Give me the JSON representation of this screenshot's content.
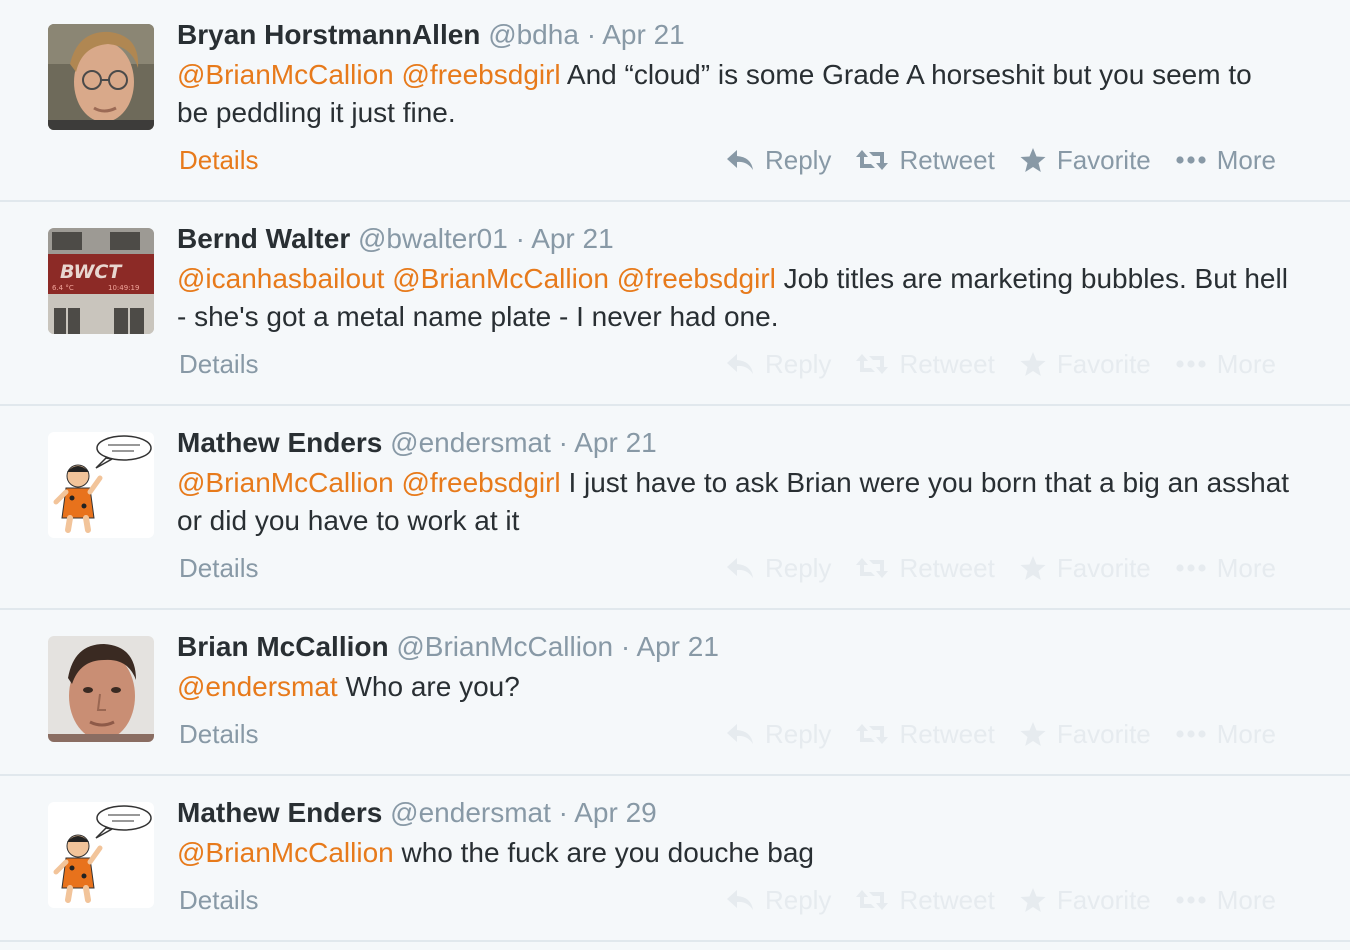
{
  "colors": {
    "mention": "#e77a1b",
    "name": "#292f33",
    "muted": "#8899a6",
    "faded_action": "#e6ebef",
    "background": "#f5f8fa"
  },
  "tweets": [
    {
      "fullname": "Bryan HorstmannAllen",
      "username": "@bdha",
      "separator": "·",
      "time": "Apr 21",
      "mentions": [
        "@BrianMcCallion",
        "@freebsdgirl"
      ],
      "text": "And “cloud” is some Grade A horseshit but you seem to be peddling it just fine.",
      "avatar_icon": "portrait-man-glasses-avatar",
      "details": "Details",
      "actions": {
        "reply": "Reply",
        "retweet": "Retweet",
        "favorite": "Favorite",
        "more": "More"
      }
    },
    {
      "fullname": "Bernd Walter",
      "username": "@bwalter01",
      "separator": "·",
      "time": "Apr 21",
      "mentions": [
        "@icanhasbailout",
        "@BrianMcCallion",
        "@freebsdgirl"
      ],
      "text": "Job titles are marketing bubbles. But hell - she's got a metal name plate - I never had one.",
      "avatar_icon": "bwct-building-sign-avatar",
      "avatar_sign_text": "BWCT",
      "avatar_sign_sub_left": "6.4 °C",
      "avatar_sign_sub_right": "10:49:19",
      "details": "Details",
      "actions": {
        "reply": "Reply",
        "retweet": "Retweet",
        "favorite": "Favorite",
        "more": "More"
      }
    },
    {
      "fullname": "Mathew Enders",
      "username": "@endersmat",
      "separator": "·",
      "time": "Apr 21",
      "mentions": [
        "@BrianMcCallion",
        "@freebsdgirl"
      ],
      "text": "I just have to ask Brian were you born that a big an asshat or did you have to work at it",
      "avatar_icon": "cartoon-caveman-avatar",
      "details": "Details",
      "actions": {
        "reply": "Reply",
        "retweet": "Retweet",
        "favorite": "Favorite",
        "more": "More"
      }
    },
    {
      "fullname": "Brian McCallion",
      "username": "@BrianMcCallion",
      "separator": "·",
      "time": "Apr 21",
      "mentions": [
        "@endersmat"
      ],
      "text": "Who are you?",
      "avatar_icon": "portrait-man-avatar",
      "details": "Details",
      "actions": {
        "reply": "Reply",
        "retweet": "Retweet",
        "favorite": "Favorite",
        "more": "More"
      }
    },
    {
      "fullname": "Mathew Enders",
      "username": "@endersmat",
      "separator": "·",
      "time": "Apr 29",
      "mentions": [
        "@BrianMcCallion"
      ],
      "text": "who the fuck are you douche bag",
      "avatar_icon": "cartoon-caveman-avatar",
      "details": "Details",
      "actions": {
        "reply": "Reply",
        "retweet": "Retweet",
        "favorite": "Favorite",
        "more": "More"
      }
    }
  ]
}
